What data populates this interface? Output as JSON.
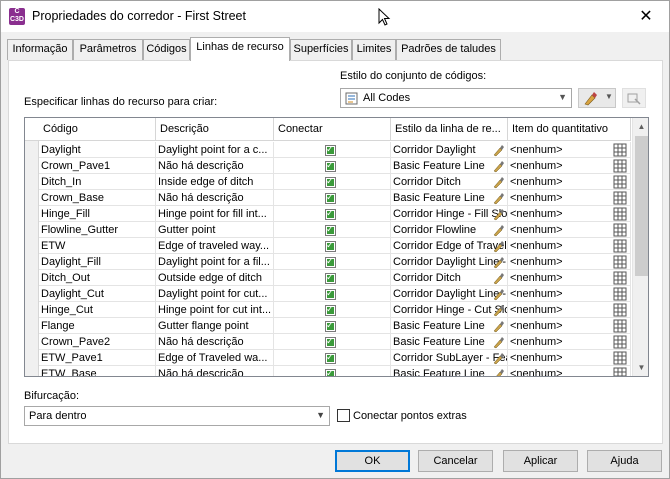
{
  "window": {
    "title": "Propriedades do corredor - First Street",
    "app_icon_text": "C\nC3D"
  },
  "tabs": [
    {
      "label": "Informação",
      "active": false
    },
    {
      "label": "Parâmetros",
      "active": false
    },
    {
      "label": "Códigos",
      "active": false
    },
    {
      "label": "Linhas de recurso",
      "active": true
    },
    {
      "label": "Superfícies",
      "active": false
    },
    {
      "label": "Limites",
      "active": false
    },
    {
      "label": "Padrões de taludes",
      "active": false
    }
  ],
  "code_set": {
    "label": "Estilo do conjunto de códigos:",
    "value": "All Codes"
  },
  "specify_label": "Especificar linhas do recurso para criar:",
  "grid": {
    "columns": [
      "Código",
      "Descrição",
      "Conectar",
      "Estilo da linha de re...",
      "Item do quantitativo"
    ],
    "rows": [
      {
        "code": "Daylight",
        "desc": "Daylight point for a c...",
        "connect": true,
        "style": "Corridor Daylight",
        "qty": "<nenhum>"
      },
      {
        "code": "Crown_Pave1",
        "desc": "Não há descrição",
        "connect": true,
        "style": "Basic Feature Line",
        "qty": "<nenhum>"
      },
      {
        "code": "Ditch_In",
        "desc": "Inside edge of ditch",
        "connect": true,
        "style": "Corridor Ditch",
        "qty": "<nenhum>"
      },
      {
        "code": "Crown_Base",
        "desc": "Não há descrição",
        "connect": true,
        "style": "Basic Feature Line",
        "qty": "<nenhum>"
      },
      {
        "code": "Hinge_Fill",
        "desc": "Hinge point for fill int...",
        "connect": true,
        "style": "Corridor Hinge - Fill Slop",
        "qty": "<nenhum>"
      },
      {
        "code": "Flowline_Gutter",
        "desc": "Gutter point",
        "connect": true,
        "style": "Corridor Flowline",
        "qty": "<nenhum>"
      },
      {
        "code": "ETW",
        "desc": "Edge of traveled way...",
        "connect": true,
        "style": "Corridor Edge of Travel",
        "qty": "<nenhum>"
      },
      {
        "code": "Daylight_Fill",
        "desc": "Daylight point for a fil...",
        "connect": true,
        "style": "Corridor Daylight Line - F",
        "qty": "<nenhum>"
      },
      {
        "code": "Ditch_Out",
        "desc": "Outside edge of ditch",
        "connect": true,
        "style": "Corridor Ditch",
        "qty": "<nenhum>"
      },
      {
        "code": "Daylight_Cut",
        "desc": "Daylight point for cut...",
        "connect": true,
        "style": "Corridor Daylight Line - C",
        "qty": "<nenhum>"
      },
      {
        "code": "Hinge_Cut",
        "desc": "Hinge point for cut int...",
        "connect": true,
        "style": "Corridor Hinge - Cut Slop",
        "qty": "<nenhum>"
      },
      {
        "code": "Flange",
        "desc": "Gutter flange point",
        "connect": true,
        "style": "Basic Feature Line",
        "qty": "<nenhum>"
      },
      {
        "code": "Crown_Pave2",
        "desc": "Não há descrição",
        "connect": true,
        "style": "Basic Feature Line",
        "qty": "<nenhum>"
      },
      {
        "code": "ETW_Pave1",
        "desc": "Edge of Traveled wa...",
        "connect": true,
        "style": "Corridor SubLayer - Fea",
        "qty": "<nenhum>"
      },
      {
        "code": "ETW_Base",
        "desc": "Não há descrição",
        "connect": true,
        "style": "Basic Feature Line",
        "qty": "<nenhum>"
      }
    ]
  },
  "bifurcation": {
    "label": "Bifurcação:",
    "value": "Para dentro"
  },
  "connect_extra": {
    "label": "Conectar pontos extras",
    "checked": false
  },
  "buttons": {
    "ok": "OK",
    "cancel": "Cancelar",
    "apply": "Aplicar",
    "help": "Ajuda"
  },
  "colors": {
    "accent": "#0078d7",
    "check_green": "#3a9a3a",
    "app_icon": "#8a2f8f"
  }
}
